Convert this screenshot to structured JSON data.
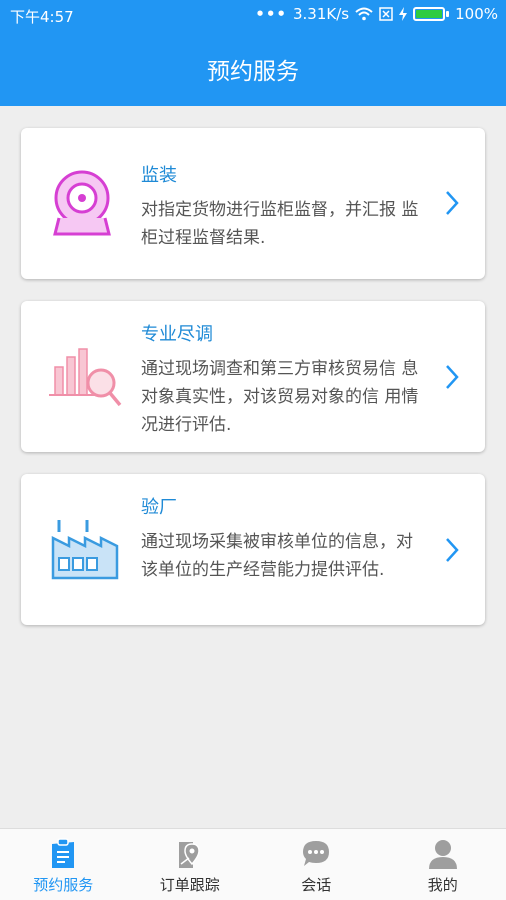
{
  "status_bar": {
    "time": "下午4:57",
    "network_speed": "3.31K/s",
    "battery": "100%"
  },
  "header": {
    "title": "预约服务"
  },
  "services": [
    {
      "title": "监装",
      "description": "对指定货物进行监柜监督，并汇报 监柜过程监督结果.",
      "icon": "camera-icon"
    },
    {
      "title": "专业尽调",
      "description": "通过现场调查和第三方审核贸易信 息对象真实性，对该贸易对象的信 用情况进行评估.",
      "icon": "chart-search-icon"
    },
    {
      "title": "验厂",
      "description": "通过现场采集被审核单位的信息，对该单位的生产经营能力提供评估.",
      "icon": "factory-icon"
    }
  ],
  "tabs": [
    {
      "label": "预约服务",
      "icon": "clipboard-icon",
      "active": true
    },
    {
      "label": "订单跟踪",
      "icon": "map-pin-icon",
      "active": false
    },
    {
      "label": "会话",
      "icon": "chat-icon",
      "active": false
    },
    {
      "label": "我的",
      "icon": "user-icon",
      "active": false
    }
  ],
  "colors": {
    "primary": "#2196f3",
    "card_title": "#1f8ad6",
    "camera": "#d63fd3",
    "chart": "#f08fa8",
    "factory": "#3a9be0"
  }
}
